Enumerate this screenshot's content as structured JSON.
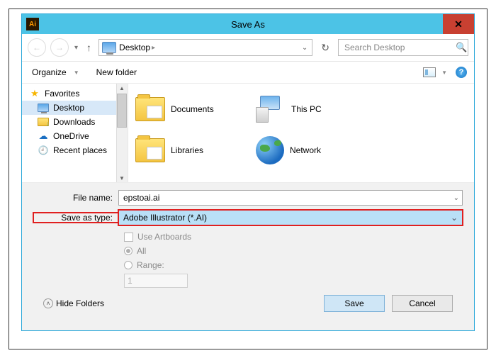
{
  "window": {
    "title": "Save As"
  },
  "nav": {
    "location": "Desktop",
    "search_placeholder": "Search Desktop"
  },
  "toolbar": {
    "organize": "Organize",
    "newfolder": "New folder"
  },
  "sidebar": {
    "items": [
      {
        "label": "Favorites",
        "icon": "star"
      },
      {
        "label": "Desktop",
        "icon": "monitor",
        "selected": true
      },
      {
        "label": "Downloads",
        "icon": "download-folder"
      },
      {
        "label": "OneDrive",
        "icon": "cloud"
      },
      {
        "label": "Recent places",
        "icon": "clock"
      }
    ]
  },
  "files": [
    {
      "label": "Documents",
      "icon": "folder"
    },
    {
      "label": "This PC",
      "icon": "pc"
    },
    {
      "label": "Libraries",
      "icon": "folder"
    },
    {
      "label": "Network",
      "icon": "globe"
    }
  ],
  "form": {
    "filename_label": "File name:",
    "filename_value": "epstoai.ai",
    "type_label": "Save as type:",
    "type_value": "Adobe Illustrator (*.AI)",
    "use_artboards": "Use Artboards",
    "all": "All",
    "range": "Range:",
    "range_value": "1"
  },
  "footer": {
    "hide_folders": "Hide Folders",
    "save": "Save",
    "cancel": "Cancel"
  }
}
